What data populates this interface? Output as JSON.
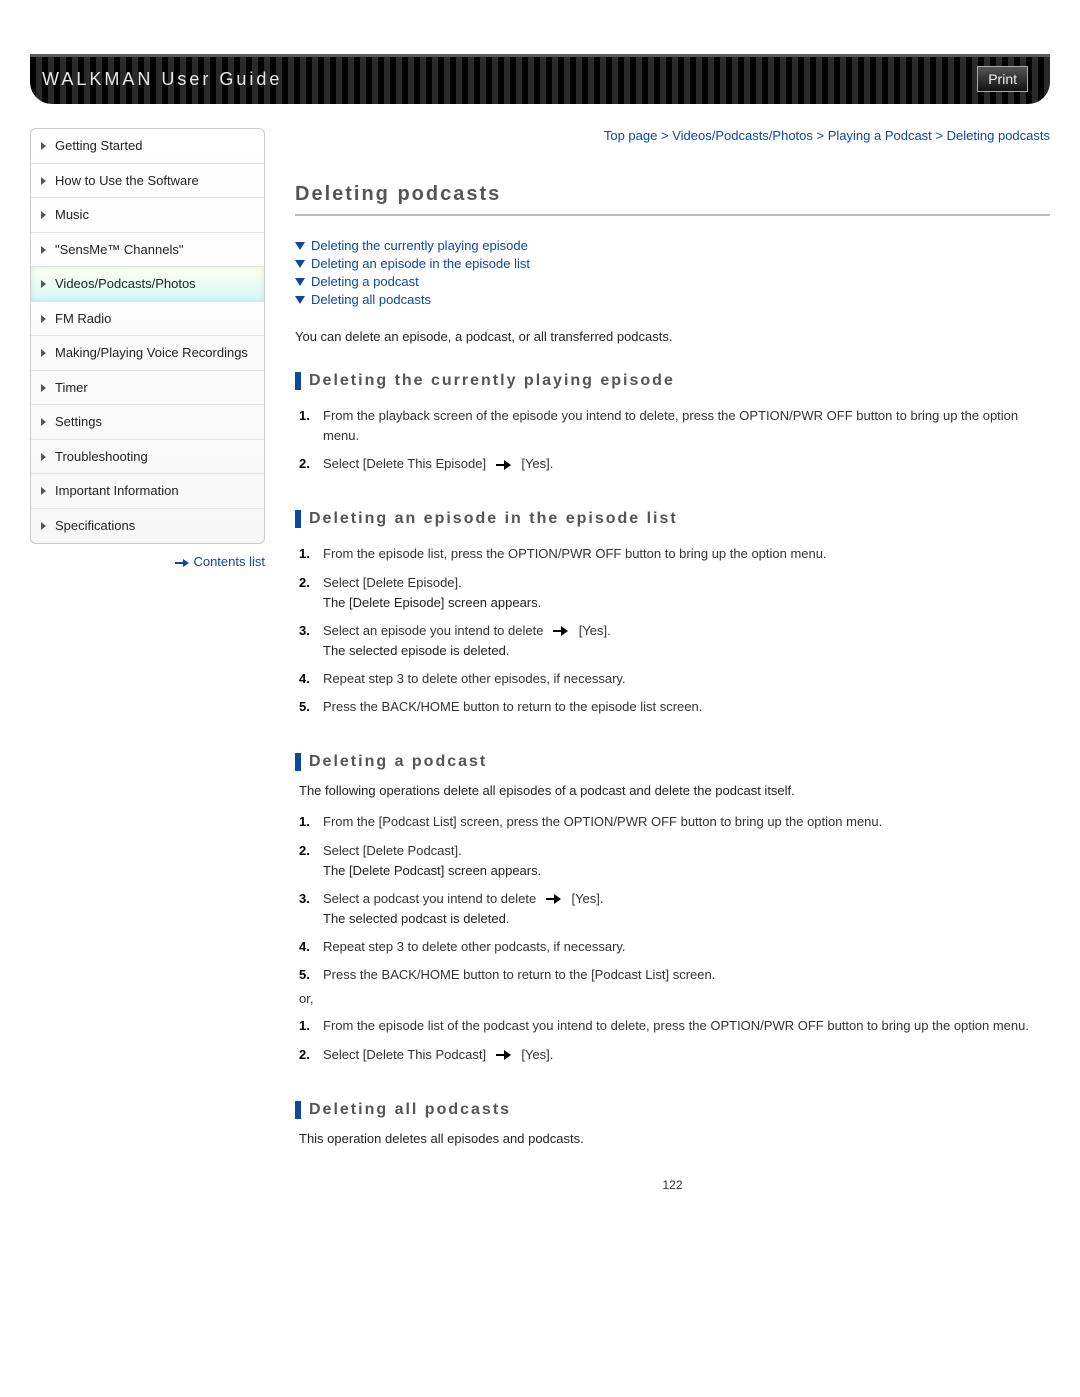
{
  "header": {
    "title": "WALKMAN User Guide",
    "print_label": "Print"
  },
  "nav": {
    "items": [
      {
        "label": "Getting Started"
      },
      {
        "label": "How to Use the Software"
      },
      {
        "label": "Music"
      },
      {
        "label": "\"SensMe™ Channels\""
      },
      {
        "label": "Videos/Podcasts/Photos",
        "active": true
      },
      {
        "label": "FM Radio"
      },
      {
        "label": "Making/Playing Voice Recordings"
      },
      {
        "label": "Timer"
      },
      {
        "label": "Settings"
      },
      {
        "label": "Troubleshooting"
      },
      {
        "label": "Important Information"
      },
      {
        "label": "Specifications"
      }
    ],
    "contents_list_label": "Contents list"
  },
  "breadcrumb": {
    "a": "Top page",
    "b": "Videos/Podcasts/Photos",
    "c": "Playing a Podcast",
    "d": "Deleting podcasts",
    "sep": ">"
  },
  "page": {
    "title": "Deleting podcasts",
    "anchors": {
      "a1": "Deleting the currently playing episode",
      "a2": "Deleting an episode in the episode list",
      "a3": "Deleting a podcast",
      "a4": "Deleting all podcasts"
    },
    "intro": "You can delete an episode, a podcast, or all transferred podcasts.",
    "s1": {
      "title": "Deleting the currently playing episode",
      "step1": "From the playback screen of the episode you intend to delete, press the OPTION/PWR OFF button to bring up the option menu.",
      "step2a": "Select [Delete This Episode]",
      "step2b": "[Yes]."
    },
    "s2": {
      "title": "Deleting an episode in the episode list",
      "step1": "From the episode list, press the OPTION/PWR OFF button to bring up the option menu.",
      "step2a": "Select [Delete Episode].",
      "step2b": "The [Delete Episode] screen appears.",
      "step3a": "Select an episode you intend to delete",
      "step3b": "[Yes].",
      "step3c": "The selected episode is deleted.",
      "step4": "Repeat step 3 to delete other episodes, if necessary.",
      "step5": "Press the BACK/HOME button to return to the episode list screen."
    },
    "s3": {
      "title": "Deleting a podcast",
      "desc": "The following operations delete all episodes of a podcast and delete the podcast itself.",
      "step1": "From the [Podcast List] screen, press the OPTION/PWR OFF button to bring up the option menu.",
      "step2a": "Select [Delete Podcast].",
      "step2b": "The [Delete Podcast] screen appears.",
      "step3a": "Select a podcast you intend to delete",
      "step3b": "[Yes].",
      "step3c": "The selected podcast is deleted.",
      "step4": "Repeat step 3 to delete other podcasts, if necessary.",
      "step5": "Press the BACK/HOME button to return to the [Podcast List] screen.",
      "or": "or,",
      "alt1": "From the episode list of the podcast you intend to delete, press the OPTION/PWR OFF button to bring up the option menu.",
      "alt2a": "Select [Delete This Podcast]",
      "alt2b": "[Yes]."
    },
    "s4": {
      "title": "Deleting all podcasts",
      "desc": "This operation deletes all episodes and podcasts."
    },
    "page_number": "122"
  }
}
